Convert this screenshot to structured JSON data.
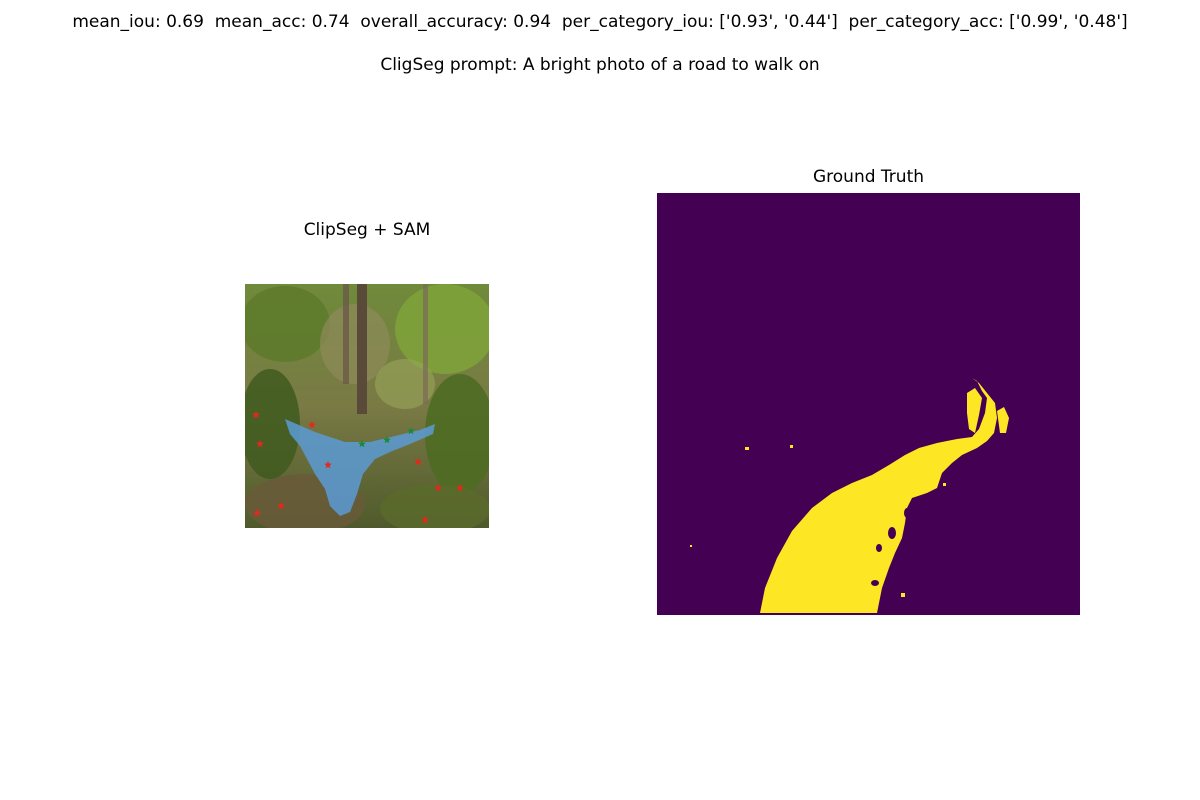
{
  "metrics_line": "mean_iou: 0.69  mean_acc: 0.74  overall_accuracy: 0.94  per_category_iou: ['0.93', '0.44']  per_category_acc: ['0.99', '0.48']",
  "prompt_line": "CligSeg prompt: A bright photo of a road to walk on",
  "left": {
    "title": "ClipSeg + SAM"
  },
  "right": {
    "title": "Ground Truth"
  },
  "colors": {
    "mask_background": "#440154",
    "mask_foreground": "#fde725",
    "sam_overlay": "#5b9bd5",
    "positive_point": "#1a8a3a",
    "negative_point": "#e8261c"
  }
}
